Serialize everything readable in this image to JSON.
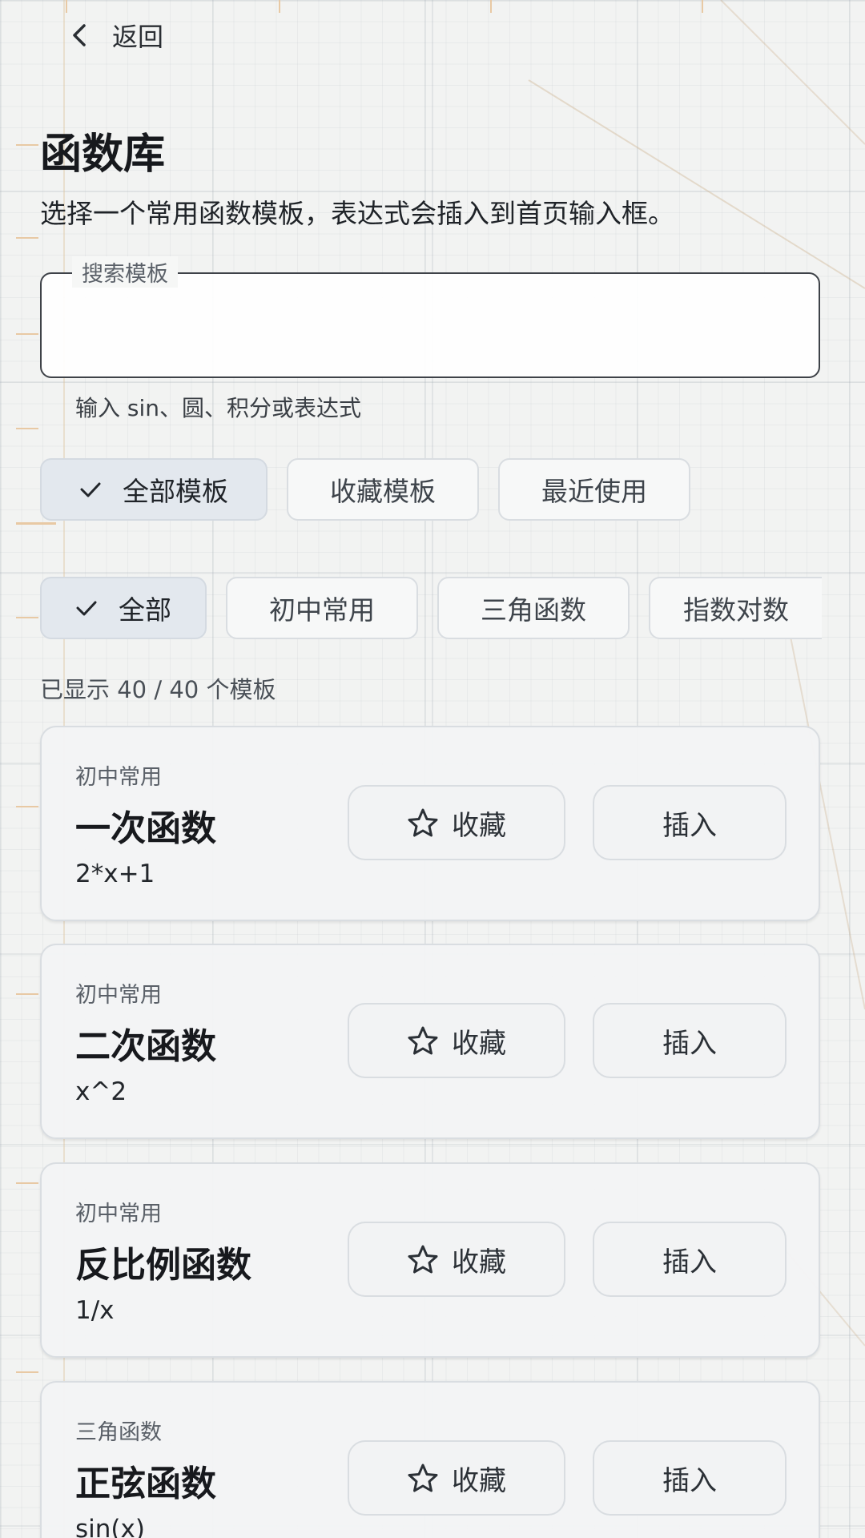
{
  "header": {
    "back_label": "返回"
  },
  "page": {
    "title": "函数库",
    "subtitle": "选择一个常用函数模板，表达式会插入到首页输入框。"
  },
  "search": {
    "label": "搜索模板",
    "value": "",
    "helper": "输入 sin、圆、积分或表达式"
  },
  "scope_filters": [
    {
      "label": "全部模板",
      "selected": true
    },
    {
      "label": "收藏模板",
      "selected": false
    },
    {
      "label": "最近使用",
      "selected": false
    }
  ],
  "category_filters": [
    {
      "label": "全部",
      "selected": true
    },
    {
      "label": "初中常用",
      "selected": false
    },
    {
      "label": "三角函数",
      "selected": false
    },
    {
      "label": "指数对数",
      "selected": false
    }
  ],
  "count_text": "已显示 40 / 40 个模板",
  "templates": [
    {
      "category": "初中常用",
      "name": "一次函数",
      "expression": "2*x+1",
      "favorite_label": "收藏",
      "insert_label": "插入"
    },
    {
      "category": "初中常用",
      "name": "二次函数",
      "expression": "x^2",
      "favorite_label": "收藏",
      "insert_label": "插入"
    },
    {
      "category": "初中常用",
      "name": "反比例函数",
      "expression": "1/x",
      "favorite_label": "收藏",
      "insert_label": "插入"
    },
    {
      "category": "三角函数",
      "name": "正弦函数",
      "expression": "sin(x)",
      "favorite_label": "收藏",
      "insert_label": "插入"
    }
  ],
  "icons": {
    "back": "chevron-left-icon",
    "check": "check-icon",
    "favorite": "star-outline-icon"
  },
  "colors": {
    "background": "#f2f3f2",
    "chip_selected": "#e3e8ee",
    "card": "#f3f4f5",
    "outline": "#3e4248"
  }
}
